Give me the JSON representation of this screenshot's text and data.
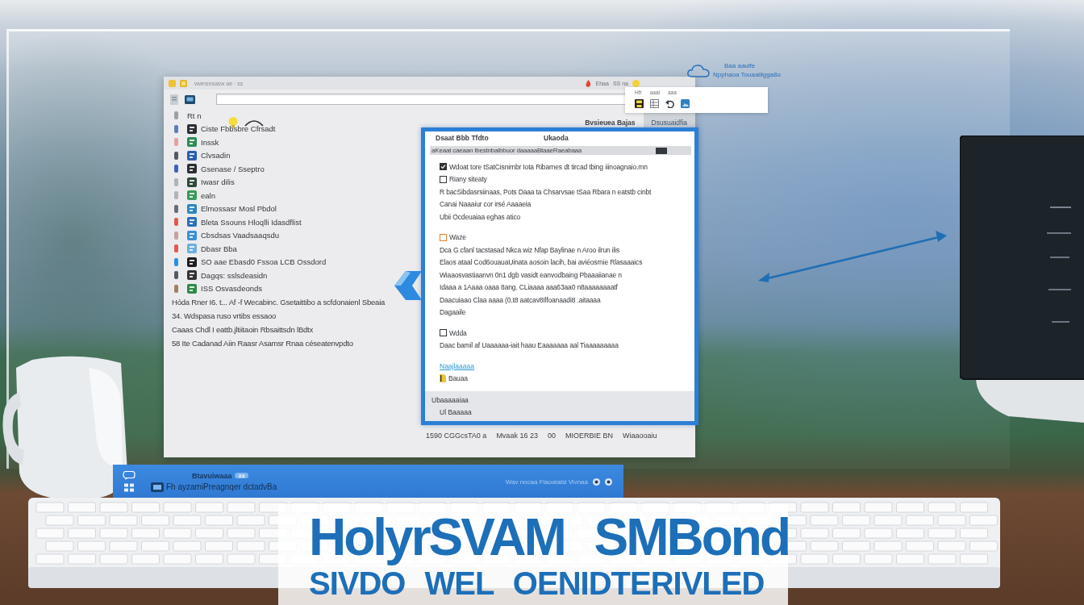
{
  "window": {
    "title": "wwnsnsasw ae · ss",
    "title_bar_labels": [
      "Ehaa",
      "SS na"
    ]
  },
  "toolbar_popup": {
    "labels": [
      "Hfr",
      "aaal",
      "aaa"
    ]
  },
  "top_right_note": {
    "lines": [
      "Baa aaulfe",
      "Npphaoa Touaaiilgga8o"
    ]
  },
  "sidebar": {
    "items": [
      {
        "label": "Rt n",
        "marker": {
          "color": "#9aa0a6"
        }
      },
      {
        "label": "Ciste Fbbsbre Cfrsadt",
        "marker": {
          "color": "#5a7fb8"
        },
        "icon": {
          "color": "#2b2f33"
        }
      },
      {
        "label": "Inssk",
        "marker": {
          "color": "#e8a0a0"
        },
        "icon": {
          "color": "#2e8b57"
        }
      },
      {
        "label": "Clvsadin",
        "marker": {
          "color": "#555a60"
        },
        "icon": {
          "color": "#2a5db0"
        }
      },
      {
        "label": "Gsenase / Sseptro",
        "marker": {
          "color": "#3b63b8"
        },
        "icon": {
          "color": "#2b2f33"
        }
      },
      {
        "label": "Iwasr dilis",
        "marker": {
          "color": "#b0b4b8"
        },
        "icon": {
          "color": "#2f4a3a"
        }
      },
      {
        "label": "ealn",
        "marker": {
          "color": "#b0b4b8"
        },
        "icon": {
          "color": "#3a9a5a"
        }
      },
      {
        "label": "Elmossasr Mosl Pbdol",
        "marker": {
          "color": "#6a6e74"
        },
        "icon": {
          "color": "#2e86c1"
        }
      },
      {
        "label": "Bleta Ssouns Hloqlli Idasdflist",
        "marker": {
          "color": "#e05a4a"
        },
        "icon": {
          "color": "#2a6fb5"
        }
      },
      {
        "label": "Cbsdsas Vaadsaaqsdu",
        "marker": {
          "color": "#c8a0a0"
        },
        "icon": {
          "color": "#3a8fd6"
        }
      },
      {
        "label": "Dbasr Bba",
        "marker": {
          "color": "#e05a4a"
        },
        "icon": {
          "color": "#6aaee6"
        }
      },
      {
        "label": "SO aae Ebasd0 Fssoa LCB Ossdord",
        "marker": {
          "color": "#2a8fe0"
        },
        "icon": {
          "color": "#1e1e1e"
        }
      },
      {
        "label": "Dagqs: sslsdeasidn",
        "marker": {
          "color": "#555a60"
        },
        "icon": {
          "color": "#333333"
        }
      },
      {
        "label": "ISS Osvasdeonds",
        "marker": {
          "color": "#a08060"
        },
        "icon": {
          "color": "#2f8a4a"
        }
      }
    ]
  },
  "notes": [
    "Hóda Rner I6. t... Af -f Wecabinc. Gsetaittibo a scfdonaienl Sbeaia",
    "34. Wdspasa ruso vrtibs essaoo",
    "Caaas Chdl I eattb.jltiitaoin Rbsaittsdn lBdtx",
    "58 Ite Cadanad Aiin Raasr Asamsr Rnaa céseatenvpdto"
  ],
  "tab_bar": {
    "label": "Bvsieuea Bajas",
    "tabs": [
      {
        "label": "Dsusuaidfia",
        "selected": true
      }
    ]
  },
  "dialog": {
    "header": [
      "Dsaat Bbb Tfdto",
      "Ukaoda"
    ],
    "bar_text": "aKeaat caeaan Ibestnbalbbuor daaaaaBtaaeRaeabaaa",
    "sections": [
      {
        "lines": [
          {
            "kind": "checkbox",
            "checked": true,
            "color": "#333333",
            "text": "Wdoat tore tSatCisnimbr Iota Ribarnes dt tircad tbing iiinoagnaio.mn"
          },
          {
            "kind": "checkbox",
            "checked": false,
            "color": "#333333",
            "text": "Riany siteaty"
          },
          {
            "kind": "text",
            "text": "R bacSibdasrsiinaas, Pots Daaa ta Chsarvsae tSaa Rbara n eatstb cinbt"
          },
          {
            "kind": "text",
            "text": "Canai Naaaiur cor irsé Aaaaeia"
          },
          {
            "kind": "text",
            "text": "Ubii Ocdeuaiaa eghas atico"
          }
        ]
      },
      {
        "lines": [
          {
            "kind": "checkbox",
            "checked": false,
            "color": "#d9822b",
            "text": "Waze"
          },
          {
            "kind": "text",
            "text": "Dca G cfanl tacstasad Nkca wiz Nfap Baylinae n Aroo ilrun ilis"
          },
          {
            "kind": "text",
            "text": "Elaos ataal Cod6ouauaUinata aosoin lacih, bai aviéosrnie Rlasaaaics"
          },
          {
            "kind": "text",
            "text": "Wiaaosvastiaanvn 0n1 dgb vasidt eanvodbaing Pbaaaiianae n"
          },
          {
            "kind": "text",
            "text": "Idaaa a 1Aaaa oaaa 8ang. CLiaaaa aaa63aa0 n8aaaaaaaatf"
          },
          {
            "kind": "text",
            "text": "Daacuiaao Claa aaaa (0.t8 aatcav8Ilfoanaadi8 .aitaaaa"
          },
          {
            "kind": "text",
            "text": "Dagaaile"
          }
        ]
      },
      {
        "lines": [
          {
            "kind": "checkbox",
            "checked": false,
            "color": "#333333",
            "text": "Wdda"
          },
          {
            "kind": "text",
            "text": "Daac bamil af Uaaaaaa-iait haau Eaaaaaaa aal Tiaaaaaaaaa"
          }
        ]
      },
      {
        "lines": [
          {
            "kind": "link",
            "text": "Naajlaaaaa"
          },
          {
            "kind": "file",
            "text": "Bauaa"
          }
        ]
      }
    ],
    "footer": [
      {
        "kind": "heading",
        "text": "Ubaaaaaiaa"
      },
      {
        "kind": "item",
        "text": "Ul Baaaaa"
      }
    ]
  },
  "status_bar": [
    "1590 CGGcsTA0 a",
    "Mvaak 16 23",
    "00",
    "MIOERBIE BN",
    "Wiaaooaiu"
  ],
  "taskbar": {
    "title": "Btavuiwaaa",
    "badge": "aa",
    "subtitle": "Fh ayzamiPreagnqer dctadvBa",
    "right_text": "Wav nocaa Flaoaiaisi Vivnaa"
  },
  "banner": {
    "lines": [
      "HolyrSVAM SMBond",
      "SIVDO WEL OENIDTERIVLED"
    ]
  }
}
